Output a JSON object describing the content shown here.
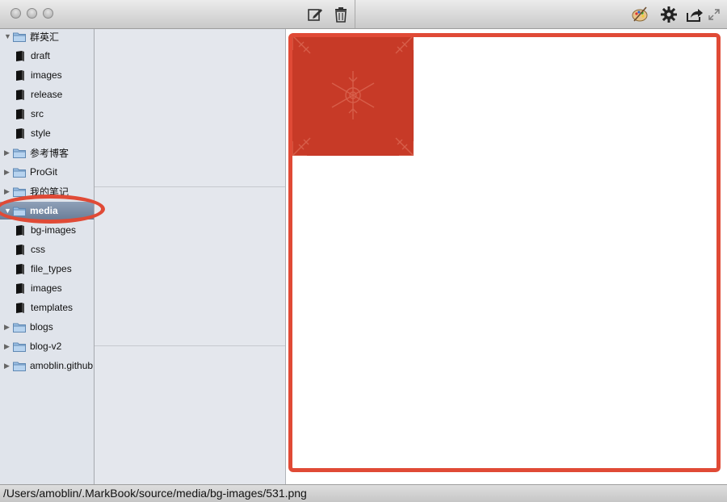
{
  "titlebar": {
    "icons": [
      "new-note-icon",
      "trash-icon",
      "palette-icon",
      "gear-icon",
      "share-icon",
      "fullscreen-icon"
    ]
  },
  "sidebar": {
    "items": [
      {
        "label": "群英汇",
        "kind": "folder",
        "expanded": true,
        "level": 0
      },
      {
        "label": "draft",
        "kind": "notebook",
        "level": 1
      },
      {
        "label": "images",
        "kind": "notebook",
        "level": 1
      },
      {
        "label": "release",
        "kind": "notebook",
        "level": 1
      },
      {
        "label": "src",
        "kind": "notebook",
        "level": 1
      },
      {
        "label": "style",
        "kind": "notebook",
        "level": 1
      },
      {
        "label": "参考博客",
        "kind": "folder",
        "expanded": false,
        "level": 0
      },
      {
        "label": "ProGit",
        "kind": "folder",
        "expanded": false,
        "level": 0
      },
      {
        "label": "我的笔记",
        "kind": "folder",
        "expanded": false,
        "level": 0
      },
      {
        "label": "media",
        "kind": "folder",
        "expanded": true,
        "selected": true,
        "level": 0
      },
      {
        "label": "bg-images",
        "kind": "notebook",
        "level": 1
      },
      {
        "label": "css",
        "kind": "notebook",
        "level": 1
      },
      {
        "label": "file_types",
        "kind": "notebook",
        "level": 1
      },
      {
        "label": "images",
        "kind": "notebook",
        "level": 1
      },
      {
        "label": "templates",
        "kind": "notebook",
        "level": 1
      },
      {
        "label": "blogs",
        "kind": "folder",
        "expanded": false,
        "level": 0
      },
      {
        "label": "blog-v2",
        "kind": "folder",
        "expanded": false,
        "level": 0
      },
      {
        "label": "amoblin.github",
        "kind": "folder",
        "expanded": false,
        "level": 0
      }
    ]
  },
  "statusbar": {
    "path": "/Users/amoblin/.MarkBook/source/media/bg-images/531.png"
  },
  "colors": {
    "annotation": "#e04a36",
    "preview_image": "#c73a27",
    "selection": "#7b8ca5"
  }
}
